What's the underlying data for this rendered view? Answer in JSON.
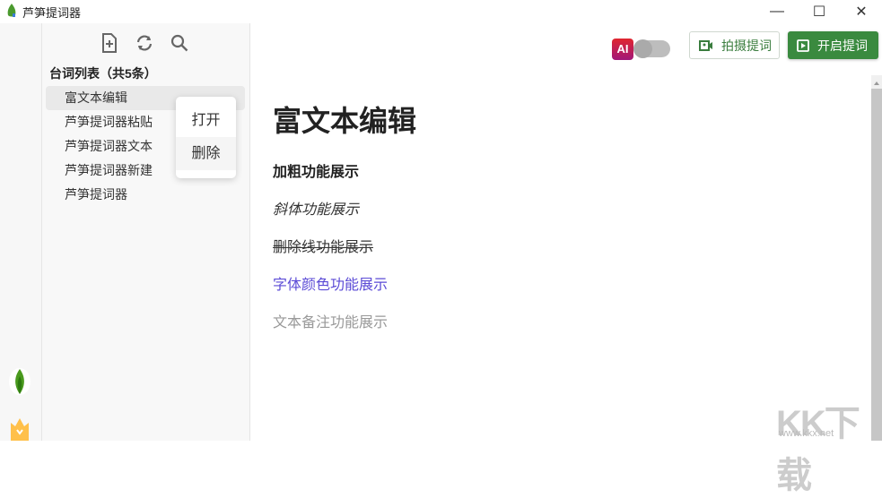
{
  "window": {
    "title": "芦笋提词器",
    "minimize": "—",
    "maximize": "☐",
    "close": "✕"
  },
  "sidebar": {
    "list_title": "台词列表（共5条）",
    "items": [
      {
        "label": "富文本编辑"
      },
      {
        "label": "芦笋提词器粘贴"
      },
      {
        "label": "芦笋提词器文本"
      },
      {
        "label": "芦笋提词器新建"
      },
      {
        "label": "芦笋提词器"
      }
    ]
  },
  "context_menu": {
    "items": [
      {
        "label": "打开"
      },
      {
        "label": "删除"
      }
    ]
  },
  "toolbar": {
    "ai_label": "AI",
    "ai_toggle_on": false,
    "shoot_label": "拍摄提词",
    "start_label": "开启提词"
  },
  "document": {
    "title": "富文本编辑",
    "bold": "加粗功能展示",
    "italic": "斜体功能展示",
    "strike": "删除线功能展示",
    "color": "字体颜色功能展示",
    "note": "文本备注功能展示"
  },
  "watermark": {
    "text": "KK下载",
    "url": "www.kkx.net"
  },
  "colors": {
    "accent": "#3a8a3f",
    "font_color_sample": "#5b4bd6",
    "note_color": "#999999"
  }
}
